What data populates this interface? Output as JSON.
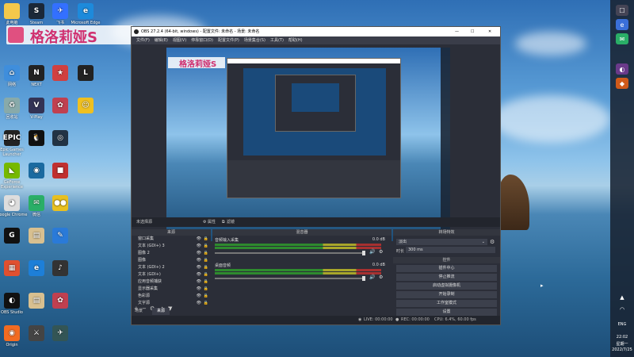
{
  "desktop": {
    "brand_banner": "格洛莉娅S",
    "icons": [
      {
        "label": "此电脑",
        "glyph": "",
        "color": "#f3c84b"
      },
      {
        "label": "Steam",
        "glyph": "S",
        "color": "#1b2838"
      },
      {
        "label": "飞书",
        "glyph": "✈",
        "color": "#3370ff"
      },
      {
        "label": "Microsoft Edge",
        "glyph": "e",
        "color": "#1d8adb"
      },
      {
        "label": "网络",
        "glyph": "⌂",
        "color": "#3f8edc"
      },
      {
        "label": "NEXT",
        "glyph": "N",
        "color": "#222"
      },
      {
        "label": "",
        "glyph": "★",
        "color": "#d04040"
      },
      {
        "label": "",
        "glyph": "L",
        "color": "#222"
      },
      {
        "label": "回收站",
        "glyph": "♻",
        "color": "#8aa"
      },
      {
        "label": "V-Play",
        "glyph": "V",
        "color": "#335"
      },
      {
        "label": "",
        "glyph": "✿",
        "color": "#c04050"
      },
      {
        "label": "",
        "glyph": "☺",
        "color": "#f0c020"
      },
      {
        "label": "Epic Games Launcher",
        "glyph": "EPIC",
        "color": "#222"
      },
      {
        "label": "",
        "glyph": "🐧",
        "color": "#111"
      },
      {
        "label": "",
        "glyph": "◎",
        "color": "#234"
      },
      {
        "label": "",
        "glyph": "",
        "color": ""
      },
      {
        "label": "GeForce Experience",
        "glyph": "◣",
        "color": "#76b900"
      },
      {
        "label": "",
        "glyph": "◉",
        "color": "#1a6aa0"
      },
      {
        "label": "",
        "glyph": "■",
        "color": "#c03030"
      },
      {
        "label": "",
        "glyph": "",
        "color": ""
      },
      {
        "label": "Google Chrome",
        "glyph": "◕",
        "color": "#ddd"
      },
      {
        "label": "微信",
        "glyph": "✉",
        "color": "#2aae67"
      },
      {
        "label": "",
        "glyph": "●●",
        "color": "#e8c020"
      },
      {
        "label": "",
        "glyph": "",
        "color": ""
      },
      {
        "label": "",
        "glyph": "G",
        "color": "#111"
      },
      {
        "label": "",
        "glyph": "▤",
        "color": "#d8c090"
      },
      {
        "label": "",
        "glyph": "✎",
        "color": "#2a7ad8"
      },
      {
        "label": "",
        "glyph": "",
        "color": ""
      },
      {
        "label": "",
        "glyph": "▦",
        "color": "#e05030"
      },
      {
        "label": "",
        "glyph": "e",
        "color": "#1d7fd8"
      },
      {
        "label": "",
        "glyph": "♪",
        "color": "#333"
      },
      {
        "label": "",
        "glyph": "",
        "color": ""
      },
      {
        "label": "OBS Studio",
        "glyph": "◐",
        "color": "#111"
      },
      {
        "label": "",
        "glyph": "▤",
        "color": "#d8c090"
      },
      {
        "label": "",
        "glyph": "✿",
        "color": "#c04050"
      },
      {
        "label": "",
        "glyph": "",
        "color": ""
      },
      {
        "label": "Origin",
        "glyph": "◉",
        "color": "#f26b21"
      },
      {
        "label": "",
        "glyph": "⚔",
        "color": "#444"
      },
      {
        "label": "",
        "glyph": "✈",
        "color": "#355"
      }
    ]
  },
  "obs": {
    "title": "OBS 27.2.4 (64-bit, windows) - 配置文件: 未命名 - 场景: 未命名",
    "window_controls": [
      "—",
      "☐",
      "✕"
    ],
    "menu": [
      "文件(F)",
      "编辑(E)",
      "视图(V)",
      "停靠窗口(D)",
      "配置文件(P)",
      "场景集合(S)",
      "工具(T)",
      "帮助(H)"
    ],
    "source_bar": {
      "no_source": "未选择源",
      "properties": "属性",
      "filters": "滤镜"
    },
    "docks": {
      "sources": "来源",
      "mixer": "混音器",
      "transitions": "转场特效",
      "controls": "控件"
    },
    "sources": [
      {
        "name": "窗口采集"
      },
      {
        "name": "文本 (GDI+) 3"
      },
      {
        "name": "图像 2"
      },
      {
        "name": "图像"
      },
      {
        "name": "文本 (GDI+) 2"
      },
      {
        "name": "文本 (GDI+)"
      },
      {
        "name": "应用音频捕获"
      },
      {
        "name": "显示器采集"
      },
      {
        "name": "色彩源"
      },
      {
        "name": "文字源"
      }
    ],
    "source_tabs": [
      "场景",
      "来源"
    ],
    "mixer": [
      {
        "name": "音频输入采集",
        "db": "0.0 dB",
        "level": 0.62
      },
      {
        "name": "桌面音频",
        "db": "0.0 dB",
        "level": 0.58
      }
    ],
    "transitions": {
      "type": "淡出",
      "duration_label": "时长",
      "duration_value": "300 ms"
    },
    "controls": [
      "插件中心",
      "停止推流",
      "启动虚拟摄像机",
      "开始录制",
      "工作室模式",
      "设置",
      "退出"
    ],
    "controls_header_btn": "控件",
    "status": {
      "live": "LIVE: 00:00:00",
      "rec": "REC: 00:00:00",
      "cpu": "CPU: 6.4%, 60.00 fps"
    }
  },
  "taskbar": {
    "lang": "ENG",
    "time": "22:02",
    "day": "星期一",
    "date": "2022/7/25"
  },
  "colors": {
    "accent": "#3a6fd8",
    "obs_bg": "#2b2e38",
    "dock_bg": "#33363f"
  }
}
